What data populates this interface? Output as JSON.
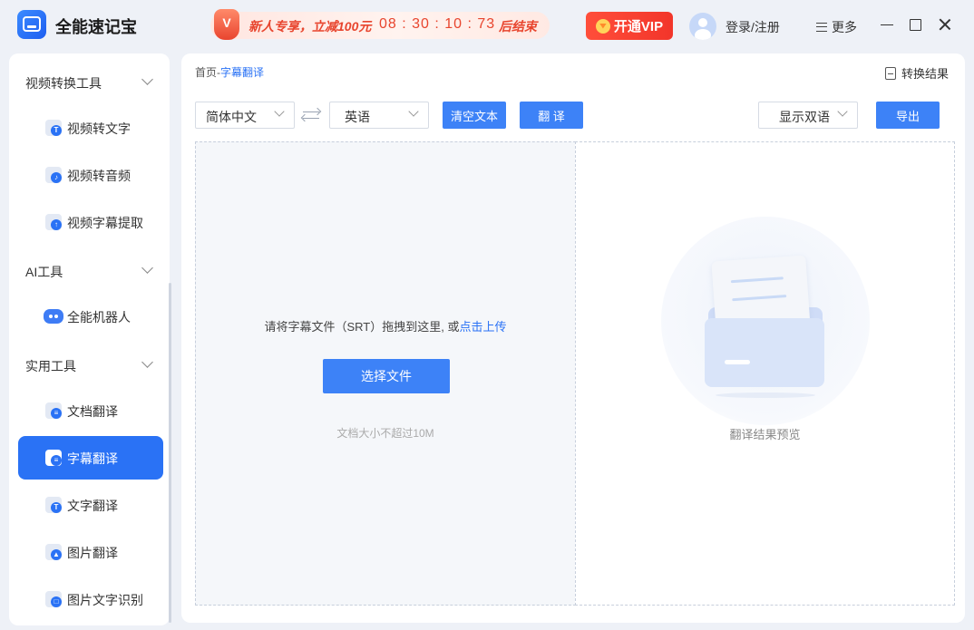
{
  "app": {
    "title": "全能速记宝",
    "logo_icon": "app-logo-icon"
  },
  "promo": {
    "icon_letter": "V",
    "text": "新人专享，立减100元",
    "timer": "08 : 30 : 10 : 73",
    "end_label": "后结束",
    "color": "#e8452e"
  },
  "header": {
    "vip_label": "开通VIP",
    "login_label": "登录/注册",
    "more_label": "更多"
  },
  "sidebar": {
    "sections": [
      {
        "label": "视频转换工具",
        "items": [
          "视频转文字",
          "视频转音频",
          "视频字幕提取"
        ]
      },
      {
        "label": "AI工具",
        "items": [
          "全能机器人"
        ]
      },
      {
        "label": "实用工具",
        "items": [
          "文档翻译",
          "字幕翻译",
          "文字翻译",
          "图片翻译",
          "图片文字识别"
        ]
      }
    ],
    "active_item": "字幕翻译",
    "accent": "#2a72f5"
  },
  "main": {
    "breadcrumb": {
      "home": "首页",
      "sep": "-",
      "current": "字幕翻译"
    },
    "results_link": "转换结果",
    "source_lang": "简体中文",
    "target_lang": "英语",
    "clear_label": "清空文本",
    "translate_label": "翻 译",
    "display_mode": "显示双语",
    "export_label": "导出",
    "drop": {
      "text": "请将字幕文件（SRT）拖拽到这里, 或",
      "link": "点击上传",
      "choose_label": "选择文件",
      "size_hint": "文档大小不超过10M"
    },
    "preview_hint": "翻译结果预览"
  }
}
